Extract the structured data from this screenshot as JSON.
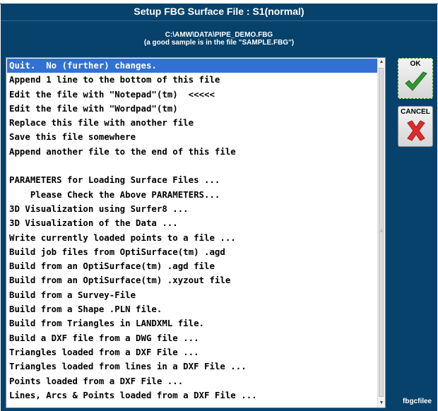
{
  "window": {
    "title": "Setup FBG Surface File : S1(normal)",
    "file_path": "C:\\AMW\\DATA\\PIPE_DEMO.FBG",
    "sample_note": "(a good sample is in the file \"SAMPLE.FBG\")"
  },
  "menu": {
    "items": [
      {
        "label": "Quit.  No (further) changes.",
        "selected": true
      },
      {
        "label": "Append 1 line to the bottom of this file"
      },
      {
        "label": "Edit the file with \"Notepad\"(tm)  <<<<<"
      },
      {
        "label": "Edit the file with \"Wordpad\"(tm)"
      },
      {
        "label": "Replace this file with another file"
      },
      {
        "label": "Save this file somewhere"
      },
      {
        "label": "Append another file to the end of this file"
      },
      {
        "label": ""
      },
      {
        "label": "PARAMETERS for Loading Surface Files ..."
      },
      {
        "label": "    Please Check the Above PARAMETERS..."
      },
      {
        "label": "3D Visualization using Surfer8 ..."
      },
      {
        "label": "3D Visualization of the Data ..."
      },
      {
        "label": "Write currently loaded points to a file ..."
      },
      {
        "label": "Build job files from OptiSurface(tm) .agd"
      },
      {
        "label": "Build from an OptiSurface(tm) .agd file"
      },
      {
        "label": "Build from an OptiSurface(tm) .xyzout file"
      },
      {
        "label": "Build from a Survey-File"
      },
      {
        "label": "Build from a Shape .PLN file."
      },
      {
        "label": "Build from Triangles in LANDXML file."
      },
      {
        "label": "Build a DXF file from a DWG file ..."
      },
      {
        "label": "Triangles loaded from a DXF File ..."
      },
      {
        "label": "Triangles loaded from lines in a DXF File ..."
      },
      {
        "label": "Points loaded from a DXF File ..."
      },
      {
        "label": "Lines, Arcs & Points loaded from a DXF File ..."
      }
    ]
  },
  "buttons": {
    "ok_label": "OK",
    "cancel_label": "CANCEL"
  },
  "footer": {
    "id_label": "fbgcfilee"
  },
  "colors": {
    "dialog_bg": "#06426b",
    "selection": "#3271d2",
    "ok_check": "#2e9a2e",
    "cancel_x": "#e02b2b"
  },
  "icons": {
    "ok": "checkmark-icon",
    "cancel": "x-icon",
    "scroll_up": "arrow-up-icon",
    "scroll_down": "arrow-down-icon"
  }
}
